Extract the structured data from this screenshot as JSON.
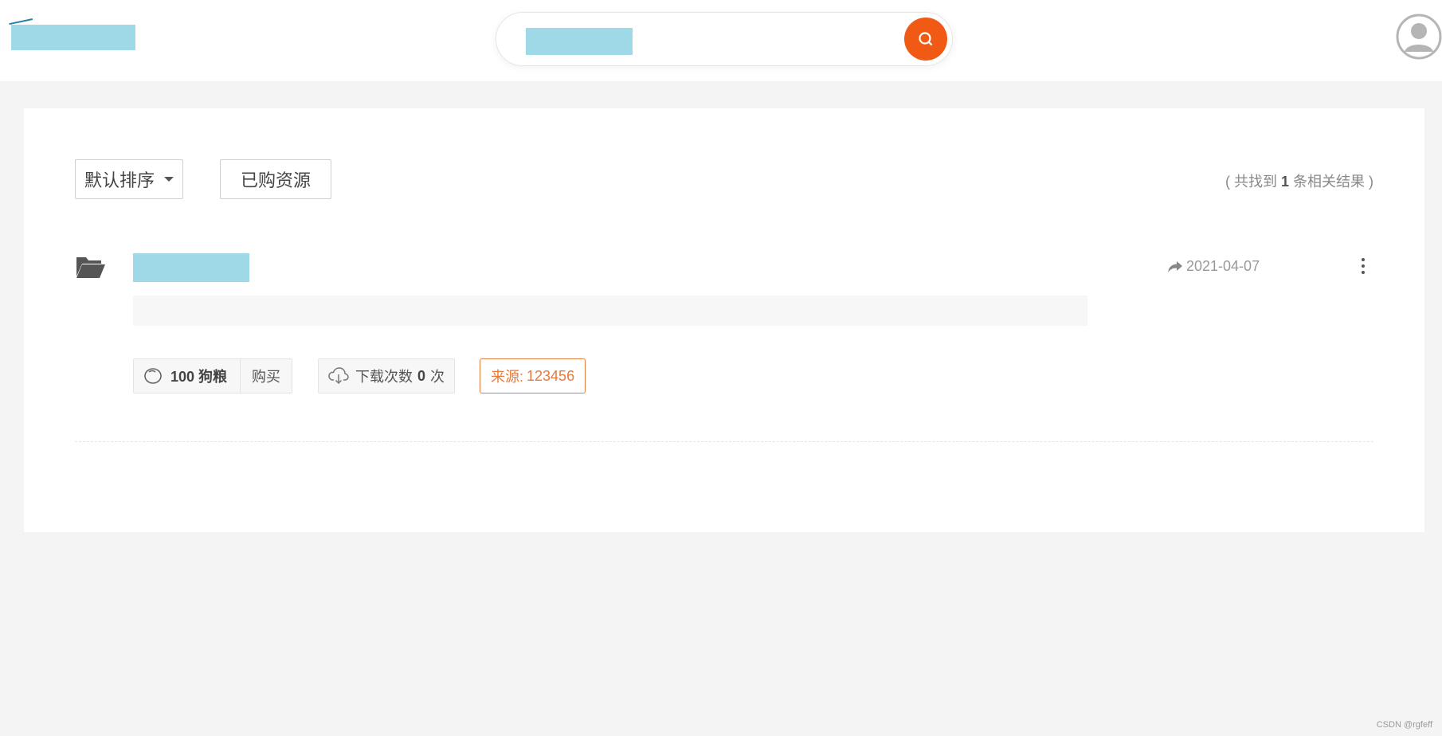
{
  "colors": {
    "accent": "#f15a14",
    "source_tag": "#e37b3c",
    "redaction": "#9fd9e8"
  },
  "header": {
    "search_button_icon": "search-icon",
    "avatar_icon": "user-avatar-icon"
  },
  "toolbar": {
    "sort_label": "默认排序",
    "purchased_label": "已购资源",
    "result_prefix": "( 共找到",
    "result_count": "1",
    "result_suffix": "条相关结果 )"
  },
  "resource": {
    "icon": "folder-icon",
    "date": "2021-04-07",
    "price_value": "100 狗粮",
    "buy_label": "购买",
    "download_prefix": "下载次数",
    "download_count": "0",
    "download_suffix": "次",
    "source_label": "来源:",
    "source_value": "123456"
  },
  "watermark": "CSDN @rgfeff"
}
